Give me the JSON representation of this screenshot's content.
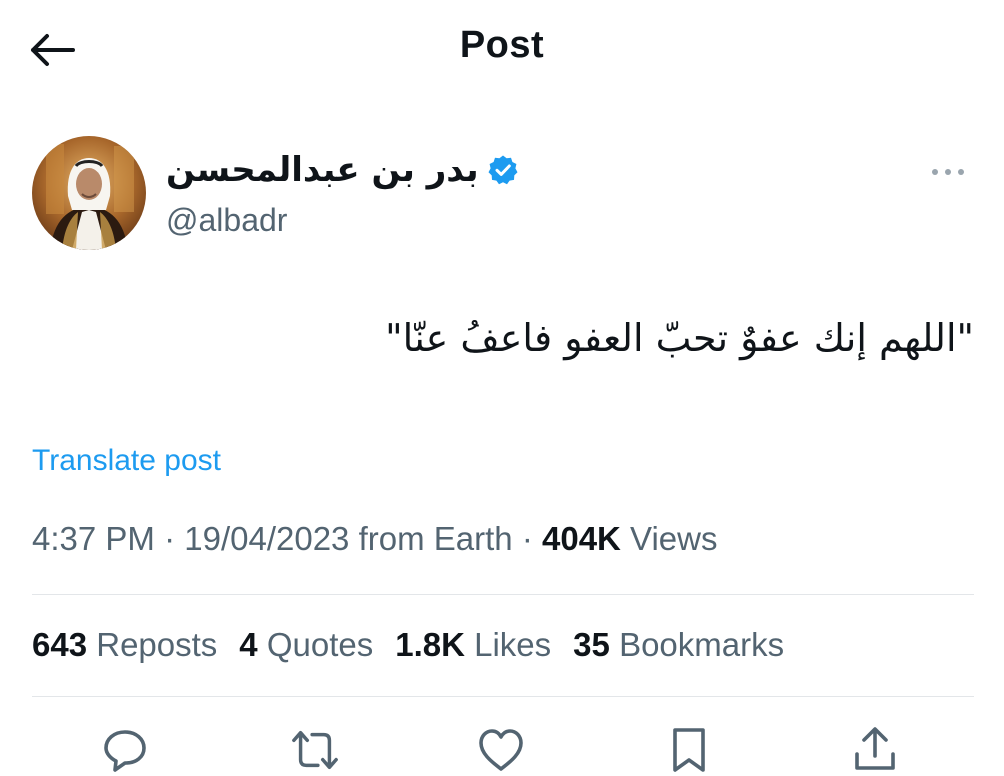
{
  "header": {
    "title": "Post",
    "back_icon": "arrow-left-icon"
  },
  "author": {
    "display_name": "بدر بن عبدالمحسن",
    "handle": "@albadr",
    "verified_color": "#1d9bf0",
    "verified_icon": "verified-badge-icon",
    "more_icon": "more-horizontal-icon"
  },
  "post": {
    "text": "\"اللهم إنك عفوٌ تحبّ العفو فاعفُ عنّا\"",
    "translate_label": "Translate post",
    "time": "4:37 PM",
    "date": "19/04/2023",
    "source": "from Earth",
    "views_count": "404K",
    "views_label": "Views",
    "separator": "·"
  },
  "stats": {
    "reposts": {
      "count": "643",
      "label": "Reposts"
    },
    "quotes": {
      "count": "4",
      "label": "Quotes"
    },
    "likes": {
      "count": "1.8K",
      "label": "Likes"
    },
    "bookmarks": {
      "count": "35",
      "label": "Bookmarks"
    }
  },
  "actions": [
    "reply-icon",
    "repost-icon",
    "like-icon",
    "bookmark-icon",
    "share-icon"
  ],
  "colors": {
    "accent": "#1d9bf0",
    "text_primary": "#0f1419",
    "text_secondary": "#536471",
    "icon": "#536471",
    "divider": "#e3e6e9"
  }
}
